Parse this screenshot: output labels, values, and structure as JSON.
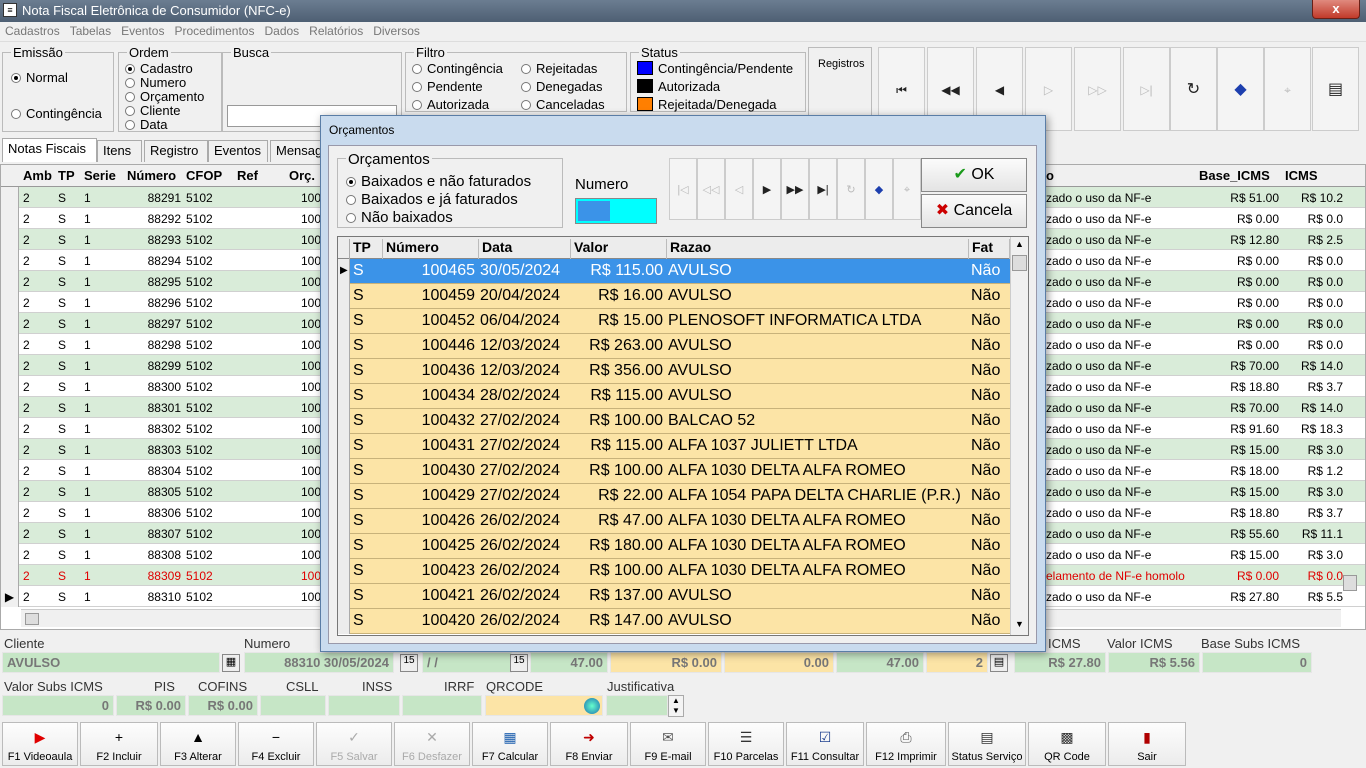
{
  "window": {
    "title": "Nota Fiscal Eletrônica de Consumidor (NFC-e)",
    "close": "x"
  },
  "menu": [
    "Cadastros",
    "Tabelas",
    "Eventos",
    "Procedimentos",
    "Dados",
    "Relatórios",
    "Diversos"
  ],
  "emissao": {
    "label": "Emissão",
    "options": [
      "Normal",
      "Contingência"
    ]
  },
  "ordem": {
    "label": "Ordem",
    "options": [
      "Cadastro",
      "Numero",
      "Orçamento",
      "Cliente",
      "Data"
    ]
  },
  "busca": {
    "label": "Busca"
  },
  "filtro": {
    "label": "Filtro",
    "col1": [
      "Contingência",
      "Pendente",
      "Autorizada"
    ],
    "col2": [
      "Rejeitadas",
      "Denegadas",
      "Canceladas"
    ]
  },
  "status": {
    "label": "Status",
    "items": [
      {
        "label": "Contingência/Pendente",
        "color": "#0000ff"
      },
      {
        "label": "Autorizada",
        "color": "#000000"
      },
      {
        "label": "Rejeitada/Denegada",
        "color": "#ff7f00"
      }
    ]
  },
  "registros": {
    "label": "Registros"
  },
  "tabs": [
    "Notas Fiscais",
    "Itens",
    "Registro",
    "Eventos",
    "Mensag"
  ],
  "main_grid": {
    "headers": [
      "Amb",
      "TP",
      "Serie",
      "Número",
      "CFOP",
      "Ref",
      "Orç.",
      "o",
      "Base_ICMS",
      "ICMS"
    ],
    "rows": [
      {
        "amb": "2",
        "tp": "S",
        "serie": "1",
        "numero": "88291",
        "cfop": "5102",
        "orc": "100",
        "msg": "zado o uso da NF-e",
        "base": "R$ 51.00",
        "icms": "R$ 10.2"
      },
      {
        "amb": "2",
        "tp": "S",
        "serie": "1",
        "numero": "88292",
        "cfop": "5102",
        "orc": "100",
        "msg": "zado o uso da NF-e",
        "base": "R$ 0.00",
        "icms": "R$ 0.0"
      },
      {
        "amb": "2",
        "tp": "S",
        "serie": "1",
        "numero": "88293",
        "cfop": "5102",
        "orc": "100",
        "msg": "zado o uso da NF-e",
        "base": "R$ 12.80",
        "icms": "R$ 2.5"
      },
      {
        "amb": "2",
        "tp": "S",
        "serie": "1",
        "numero": "88294",
        "cfop": "5102",
        "orc": "100",
        "msg": "zado o uso da NF-e",
        "base": "R$ 0.00",
        "icms": "R$ 0.0"
      },
      {
        "amb": "2",
        "tp": "S",
        "serie": "1",
        "numero": "88295",
        "cfop": "5102",
        "orc": "100",
        "msg": "zado o uso da NF-e",
        "base": "R$ 0.00",
        "icms": "R$ 0.0"
      },
      {
        "amb": "2",
        "tp": "S",
        "serie": "1",
        "numero": "88296",
        "cfop": "5102",
        "orc": "100",
        "msg": "zado o uso da NF-e",
        "base": "R$ 0.00",
        "icms": "R$ 0.0"
      },
      {
        "amb": "2",
        "tp": "S",
        "serie": "1",
        "numero": "88297",
        "cfop": "5102",
        "orc": "100",
        "msg": "zado o uso da NF-e",
        "base": "R$ 0.00",
        "icms": "R$ 0.0"
      },
      {
        "amb": "2",
        "tp": "S",
        "serie": "1",
        "numero": "88298",
        "cfop": "5102",
        "orc": "100",
        "msg": "zado o uso da NF-e",
        "base": "R$ 0.00",
        "icms": "R$ 0.0"
      },
      {
        "amb": "2",
        "tp": "S",
        "serie": "1",
        "numero": "88299",
        "cfop": "5102",
        "orc": "100",
        "msg": "zado o uso da NF-e",
        "base": "R$ 70.00",
        "icms": "R$ 14.0"
      },
      {
        "amb": "2",
        "tp": "S",
        "serie": "1",
        "numero": "88300",
        "cfop": "5102",
        "orc": "100",
        "msg": "zado o uso da NF-e",
        "base": "R$ 18.80",
        "icms": "R$ 3.7"
      },
      {
        "amb": "2",
        "tp": "S",
        "serie": "1",
        "numero": "88301",
        "cfop": "5102",
        "orc": "100",
        "msg": "zado o uso da NF-e",
        "base": "R$ 70.00",
        "icms": "R$ 14.0"
      },
      {
        "amb": "2",
        "tp": "S",
        "serie": "1",
        "numero": "88302",
        "cfop": "5102",
        "orc": "100",
        "msg": "zado o uso da NF-e",
        "base": "R$ 91.60",
        "icms": "R$ 18.3"
      },
      {
        "amb": "2",
        "tp": "S",
        "serie": "1",
        "numero": "88303",
        "cfop": "5102",
        "orc": "100",
        "msg": "zado o uso da NF-e",
        "base": "R$ 15.00",
        "icms": "R$ 3.0"
      },
      {
        "amb": "2",
        "tp": "S",
        "serie": "1",
        "numero": "88304",
        "cfop": "5102",
        "orc": "100",
        "msg": "zado o uso da NF-e",
        "base": "R$ 18.00",
        "icms": "R$ 1.2"
      },
      {
        "amb": "2",
        "tp": "S",
        "serie": "1",
        "numero": "88305",
        "cfop": "5102",
        "orc": "100",
        "msg": "zado o uso da NF-e",
        "base": "R$ 15.00",
        "icms": "R$ 3.0"
      },
      {
        "amb": "2",
        "tp": "S",
        "serie": "1",
        "numero": "88306",
        "cfop": "5102",
        "orc": "100",
        "msg": "zado o uso da NF-e",
        "base": "R$ 18.80",
        "icms": "R$ 3.7"
      },
      {
        "amb": "2",
        "tp": "S",
        "serie": "1",
        "numero": "88307",
        "cfop": "5102",
        "orc": "100",
        "msg": "zado o uso da NF-e",
        "base": "R$ 55.60",
        "icms": "R$ 11.1"
      },
      {
        "amb": "2",
        "tp": "S",
        "serie": "1",
        "numero": "88308",
        "cfop": "5102",
        "orc": "100",
        "msg": "zado o uso da NF-e",
        "base": "R$ 15.00",
        "icms": "R$ 3.0"
      },
      {
        "amb": "2",
        "tp": "S",
        "serie": "1",
        "numero": "88309",
        "cfop": "5102",
        "orc": "100",
        "msg": "elamento de NF-e homolo",
        "base": "R$ 0.00",
        "icms": "R$ 0.0",
        "red": true
      },
      {
        "amb": "2",
        "tp": "S",
        "serie": "1",
        "numero": "88310",
        "cfop": "5102",
        "orc": "100",
        "msg": "zado o uso da NF-e",
        "base": "R$ 27.80",
        "icms": "R$ 5.5",
        "current": true
      }
    ]
  },
  "dialog": {
    "title": "Orçamentos",
    "group_label": "Orçamentos",
    "options": [
      "Baixados e não faturados",
      "Baixados e já faturados",
      "Não baixados"
    ],
    "numero_label": "Numero",
    "ok": "OK",
    "cancel": "Cancela",
    "headers": [
      "TP",
      "Número",
      "Data",
      "Valor",
      "Razao",
      "Fat"
    ],
    "rows": [
      {
        "tp": "S",
        "numero": "100465",
        "data": "30/05/2024",
        "valor": "R$ 115.00",
        "razao": "AVULSO",
        "fat": "Não"
      },
      {
        "tp": "S",
        "numero": "100459",
        "data": "20/04/2024",
        "valor": "R$ 16.00",
        "razao": "AVULSO",
        "fat": "Não"
      },
      {
        "tp": "S",
        "numero": "100452",
        "data": "06/04/2024",
        "valor": "R$ 15.00",
        "razao": "PLENOSOFT INFORMATICA LTDA",
        "fat": "Não"
      },
      {
        "tp": "S",
        "numero": "100446",
        "data": "12/03/2024",
        "valor": "R$ 263.00",
        "razao": "AVULSO",
        "fat": "Não"
      },
      {
        "tp": "S",
        "numero": "100436",
        "data": "12/03/2024",
        "valor": "R$ 356.00",
        "razao": "AVULSO",
        "fat": "Não"
      },
      {
        "tp": "S",
        "numero": "100434",
        "data": "28/02/2024",
        "valor": "R$ 115.00",
        "razao": "AVULSO",
        "fat": "Não"
      },
      {
        "tp": "S",
        "numero": "100432",
        "data": "27/02/2024",
        "valor": "R$ 100.00",
        "razao": "BALCAO 52",
        "fat": "Não"
      },
      {
        "tp": "S",
        "numero": "100431",
        "data": "27/02/2024",
        "valor": "R$ 115.00",
        "razao": "ALFA 1037 JULIETT LTDA",
        "fat": "Não"
      },
      {
        "tp": "S",
        "numero": "100430",
        "data": "27/02/2024",
        "valor": "R$ 100.00",
        "razao": "ALFA 1030 DELTA ALFA ROMEO",
        "fat": "Não"
      },
      {
        "tp": "S",
        "numero": "100429",
        "data": "27/02/2024",
        "valor": "R$ 22.00",
        "razao": "ALFA 1054 PAPA DELTA CHARLIE (P.R.)",
        "fat": "Não"
      },
      {
        "tp": "S",
        "numero": "100426",
        "data": "26/02/2024",
        "valor": "R$ 47.00",
        "razao": "ALFA 1030 DELTA ALFA ROMEO",
        "fat": "Não"
      },
      {
        "tp": "S",
        "numero": "100425",
        "data": "26/02/2024",
        "valor": "R$ 180.00",
        "razao": "ALFA 1030 DELTA ALFA ROMEO",
        "fat": "Não"
      },
      {
        "tp": "S",
        "numero": "100423",
        "data": "26/02/2024",
        "valor": "R$ 100.00",
        "razao": "ALFA 1030 DELTA ALFA ROMEO",
        "fat": "Não"
      },
      {
        "tp": "S",
        "numero": "100421",
        "data": "26/02/2024",
        "valor": "R$ 137.00",
        "razao": "AVULSO",
        "fat": "Não"
      },
      {
        "tp": "S",
        "numero": "100420",
        "data": "26/02/2024",
        "valor": "R$ 147.00",
        "razao": "AVULSO",
        "fat": "Não"
      }
    ]
  },
  "bottom": {
    "cliente_label": "Cliente",
    "cliente_value": "AVULSO",
    "numero_label": "Numero",
    "numero_value": "88310 30/05/2024",
    "date2": "/ /",
    "v1": "47.00",
    "v2": "R$ 0.00",
    "v3": "0.00",
    "v4": "47.00",
    "v5": "2",
    "icms_label": "ICMS",
    "icms_value": "R$ 27.80",
    "valor_icms_label": "Valor ICMS",
    "valor_icms_value": "R$ 5.56",
    "base_subs_label": "Base Subs ICMS",
    "base_subs_value": "0",
    "valor_subs_label": "Valor Subs ICMS",
    "valor_subs_value": "0",
    "pis_label": "PIS",
    "pis_value": "R$ 0.00",
    "cofins_label": "COFINS",
    "cofins_value": "R$ 0.00",
    "csll_label": "CSLL",
    "inss_label": "INSS",
    "irrf_label": "IRRF",
    "qrcode_label": "QRCODE",
    "justificativa_label": "Justificativa"
  },
  "footer": [
    {
      "label": "F1 Videoaula",
      "icon": "▶",
      "color": "#e00000"
    },
    {
      "label": "F2 Incluir",
      "icon": "+",
      "color": "#000"
    },
    {
      "label": "F3 Alterar",
      "icon": "▲",
      "color": "#000"
    },
    {
      "label": "F4 Excluir",
      "icon": "−",
      "color": "#000"
    },
    {
      "label": "F5 Salvar",
      "icon": "✓",
      "color": "#aaa",
      "disabled": true
    },
    {
      "label": "F6 Desfazer",
      "icon": "✕",
      "color": "#aaa",
      "disabled": true
    },
    {
      "label": "F7 Calcular",
      "icon": "▦",
      "color": "#1d5fae"
    },
    {
      "label": "F8 Enviar",
      "icon": "➜",
      "color": "#c00000"
    },
    {
      "label": "F9 E-mail",
      "icon": "✉",
      "color": "#555"
    },
    {
      "label": "F10 Parcelas",
      "icon": "☰",
      "color": "#333"
    },
    {
      "label": "F11 Consultar",
      "icon": "☑",
      "color": "#1d3f8e"
    },
    {
      "label": "F12 Imprimir",
      "icon": "⎙",
      "color": "#555"
    },
    {
      "label": "Status Serviço",
      "icon": "▤",
      "color": "#333"
    },
    {
      "label": "QR Code",
      "icon": "▩",
      "color": "#333"
    },
    {
      "label": "Sair",
      "icon": "▮",
      "color": "#b00000"
    }
  ]
}
